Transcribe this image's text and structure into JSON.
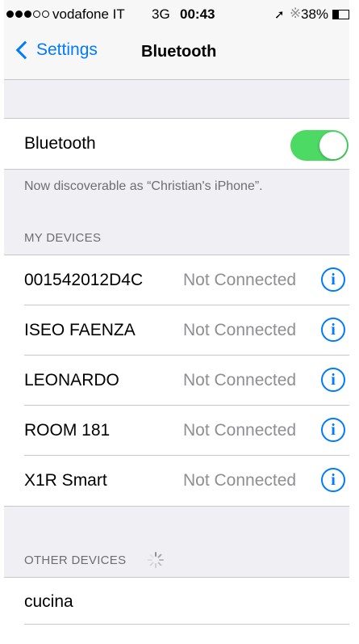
{
  "status_bar": {
    "carrier": "vodafone IT",
    "network": "3G",
    "time": "00:43",
    "battery_percent": "38%",
    "signal_bars_filled": 3,
    "signal_bars_total": 5,
    "battery_level": 0.38
  },
  "nav": {
    "back_label": "Settings",
    "title": "Bluetooth"
  },
  "bluetooth_toggle": {
    "label": "Bluetooth",
    "enabled": true,
    "on_color": "#4cd964"
  },
  "discoverable_note": "Now discoverable as “Christian's iPhone”.",
  "my_devices": {
    "header": "MY DEVICES",
    "items": [
      {
        "name": "001542012D4C",
        "status": "Not Connected"
      },
      {
        "name": "ISEO FAENZA",
        "status": "Not Connected"
      },
      {
        "name": "LEONARDO",
        "status": "Not Connected"
      },
      {
        "name": "ROOM 181",
        "status": "Not Connected"
      },
      {
        "name": "X1R Smart",
        "status": "Not Connected"
      }
    ]
  },
  "other_devices": {
    "header": "OTHER DEVICES",
    "items": [
      {
        "name": "cucina"
      }
    ]
  },
  "icons": {
    "back": "chevron-left-icon",
    "info": "info-icon",
    "info_glyph": "i",
    "spinner": "activity-spinner-icon",
    "location": "location-arrow-icon",
    "bluetooth_status": "bluetooth-icon"
  },
  "colors": {
    "accent": "#007aff",
    "background": "#efeff4",
    "secondary_text": "#8e8e93"
  }
}
